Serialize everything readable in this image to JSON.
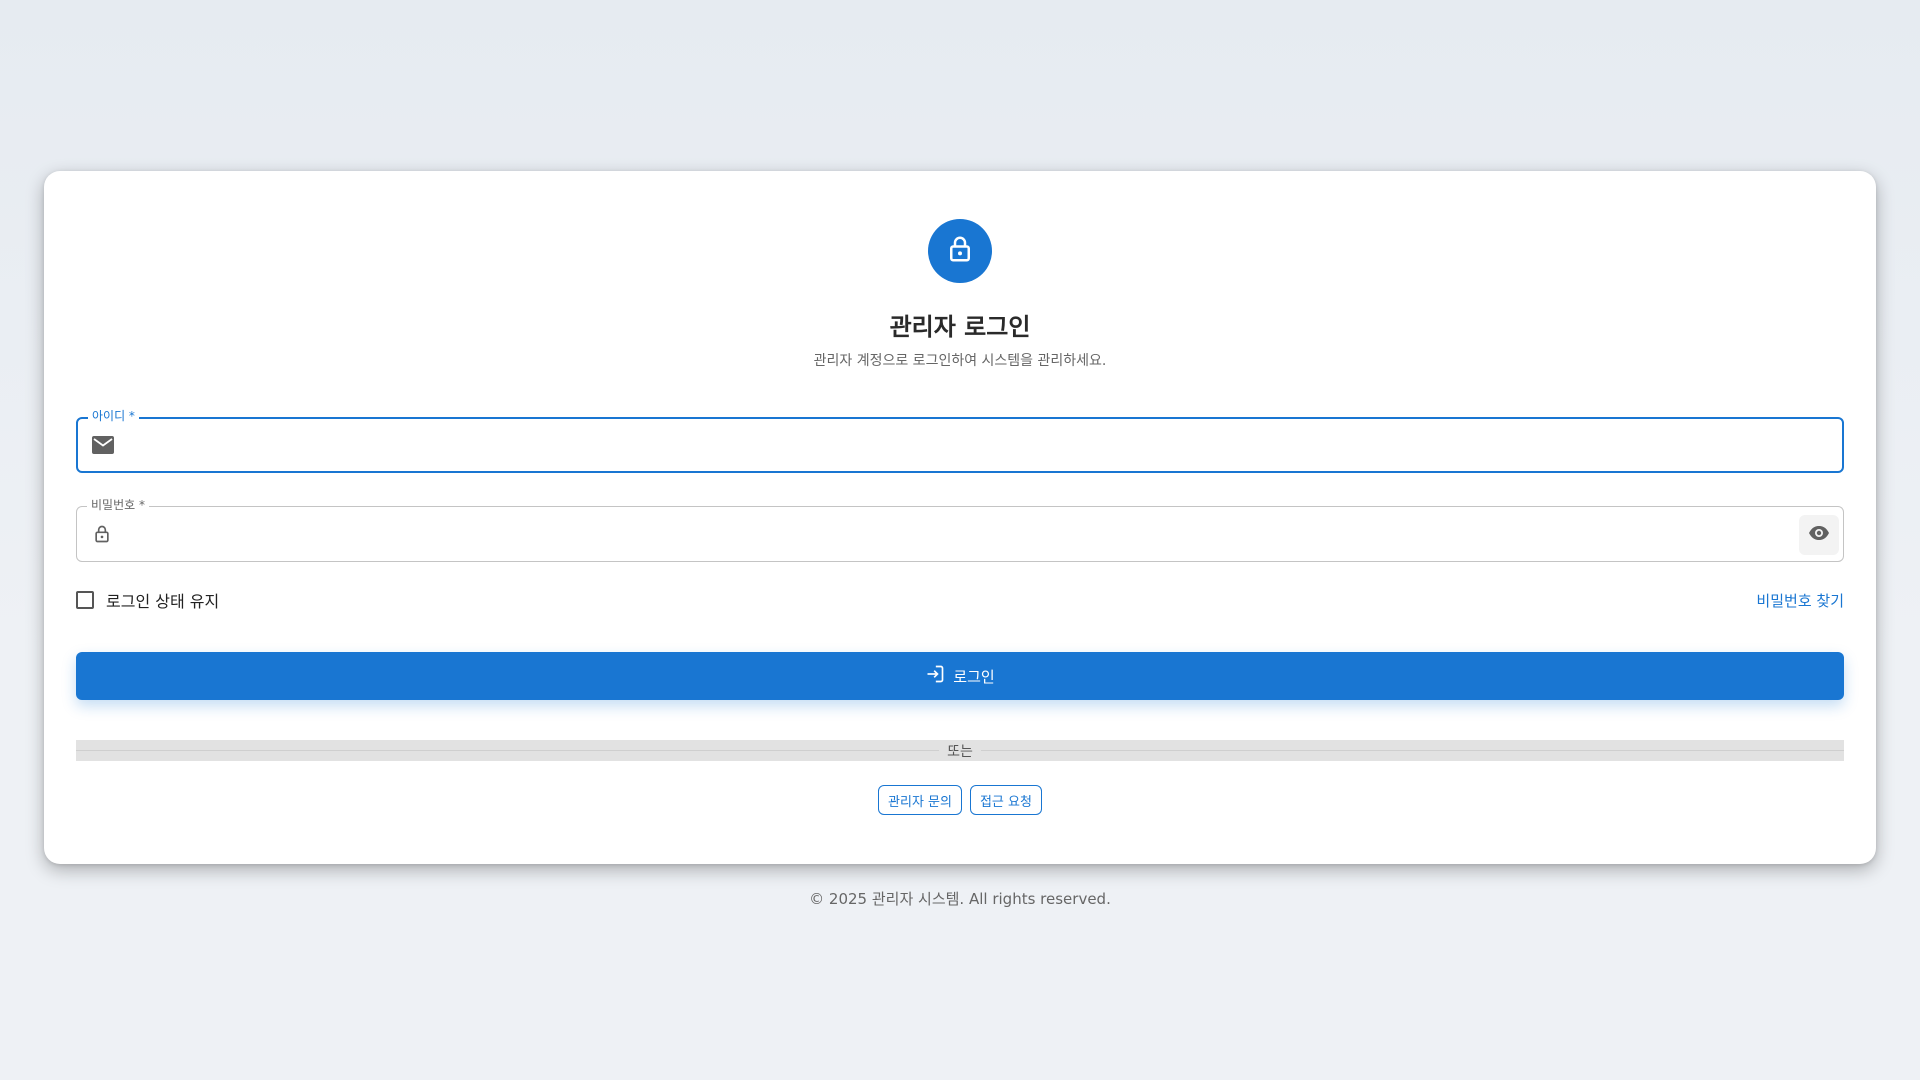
{
  "header": {
    "title": "관리자 로그인",
    "subtitle": "관리자 계정으로 로그인하여 시스템을 관리하세요.",
    "avatar_icon": "lock-icon"
  },
  "form": {
    "username": {
      "label": "아이디 *",
      "value": "",
      "icon": "mail-icon"
    },
    "password": {
      "label": "비밀번호 *",
      "value": "",
      "icon": "lock-icon",
      "toggle_icon": "eye-icon"
    },
    "remember_label": "로그인 상태 유지",
    "remember_checked": false,
    "forgot_label": "비밀번호 찾기",
    "submit_label": "로그인",
    "submit_icon": "login-icon"
  },
  "divider_text": "또는",
  "secondary_buttons": [
    {
      "label": "관리자 문의"
    },
    {
      "label": "접근 요청"
    }
  ],
  "footer": "© 2025 관리자 시스템. All rights reserved.",
  "colors": {
    "primary": "#1976d2",
    "background": "#e9edf2",
    "card": "#ffffff"
  }
}
